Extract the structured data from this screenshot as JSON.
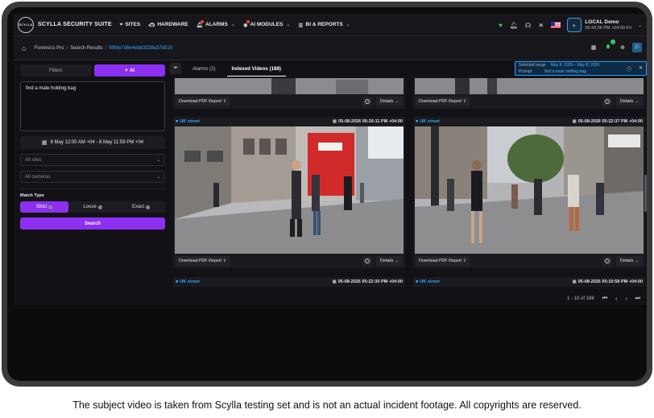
{
  "app": {
    "title": "SCYLLA SECURITY SUITE",
    "logo_text": "SCYLLA"
  },
  "nav": {
    "items": [
      {
        "label": "SITES",
        "icon": "location-pin-icon"
      },
      {
        "label": "HARDWARE",
        "icon": "car-icon"
      },
      {
        "label": "ALARMS",
        "icon": "bell-icon"
      },
      {
        "label": "AI MODULES",
        "icon": "ai-icon"
      },
      {
        "label": "BI & REPORTS",
        "icon": "bar-chart-icon"
      }
    ]
  },
  "user": {
    "name": "LOCAL Demo",
    "time": "05:43:36 PM +04:00 Fri"
  },
  "breadcrumb": {
    "items": [
      "Forensics Pro",
      "Search Results"
    ],
    "current": "69fde7d6e4ebb3338a37b518"
  },
  "left_panel": {
    "tabs": {
      "filters": "Filters",
      "ai": "AI"
    },
    "prompt_text": "find a male holding bag",
    "date_range": "8 May 12:00 AM +04 - 8 May 11:59 PM +04",
    "sites_placeholder": "All sites",
    "cameras_placeholder": "All cameras",
    "match_type_label": "Match Type",
    "match_options": [
      "Strict",
      "Loose",
      "Exact"
    ],
    "selected_match": "Strict",
    "search_label": "Search"
  },
  "tabs": {
    "alarms": "Alarms (2)",
    "indexed_videos": "Indexed Videos (188)"
  },
  "range_box": {
    "selected_range_label": "Selected range",
    "selected_range_value": "May 8, 2026 – May 8, 2026",
    "prompt_label": "Prompt",
    "prompt_value": "find a male holding bag"
  },
  "cards": {
    "download_label": "Download PDF Report",
    "details_label": "Details →",
    "row2": [
      {
        "camera": "UK street",
        "time": "05-08-2026 05:26:11 PM +04:00"
      },
      {
        "camera": "UK street",
        "time": "05-08-2026 05:22:37 PM +04:00"
      }
    ],
    "row3": [
      {
        "camera": "UK street",
        "time": "05-08-2026 05:22:30 PM +04:00"
      },
      {
        "camera": "UK street",
        "time": "05-08-2026 05:10:58 PM +04:00"
      }
    ]
  },
  "pager": {
    "range": "1 - 10 of 188"
  },
  "caption": "The subject video is taken from Scylla testing set and is not an actual incident footage. All copyrights are reserved.",
  "colors": {
    "accent_purple": "#8c2ff0",
    "accent_blue": "#2fa8ff",
    "status_green": "#2fd26f"
  }
}
